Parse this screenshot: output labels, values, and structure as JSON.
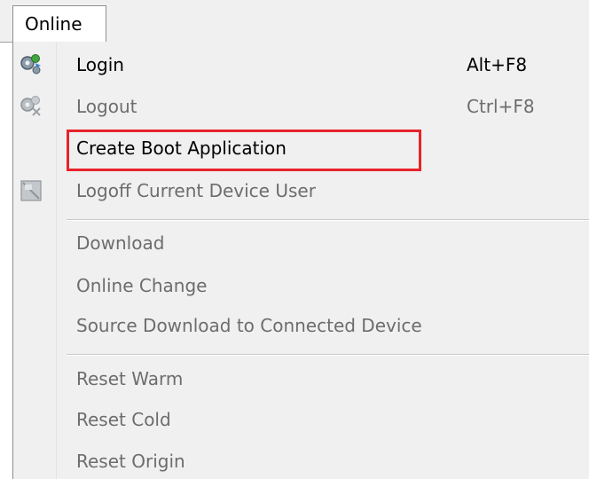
{
  "menubar": {
    "tab_label": "Online"
  },
  "menu": {
    "items": [
      {
        "label": "Login",
        "shortcut": "Alt+F8",
        "icon": "gears-connect-icon",
        "enabled": true
      },
      {
        "label": "Logout",
        "shortcut": "Ctrl+F8",
        "icon": "gears-disconnect-icon",
        "enabled": false
      },
      {
        "label": "Create Boot Application",
        "shortcut": "",
        "icon": "",
        "enabled": true
      },
      {
        "label": "Logoff Current Device User",
        "shortcut": "",
        "icon": "user-logoff-icon",
        "enabled": false
      },
      {
        "label": "Download",
        "shortcut": "",
        "icon": "",
        "enabled": false
      },
      {
        "label": "Online Change",
        "shortcut": "",
        "icon": "",
        "enabled": false
      },
      {
        "label": "Source Download to Connected Device",
        "shortcut": "",
        "icon": "",
        "enabled": false
      },
      {
        "label": "Reset Warm",
        "shortcut": "",
        "icon": "",
        "enabled": false
      },
      {
        "label": "Reset Cold",
        "shortcut": "",
        "icon": "",
        "enabled": false
      },
      {
        "label": "Reset Origin",
        "shortcut": "",
        "icon": "",
        "enabled": false
      }
    ]
  },
  "annotation": {
    "highlight_color": "#e8232a",
    "highlighted_item": "Create Boot Application"
  },
  "colors": {
    "menu_background": "#f0f0f0",
    "enabled_text": "#000000",
    "disabled_text": "#6d6d6d"
  }
}
